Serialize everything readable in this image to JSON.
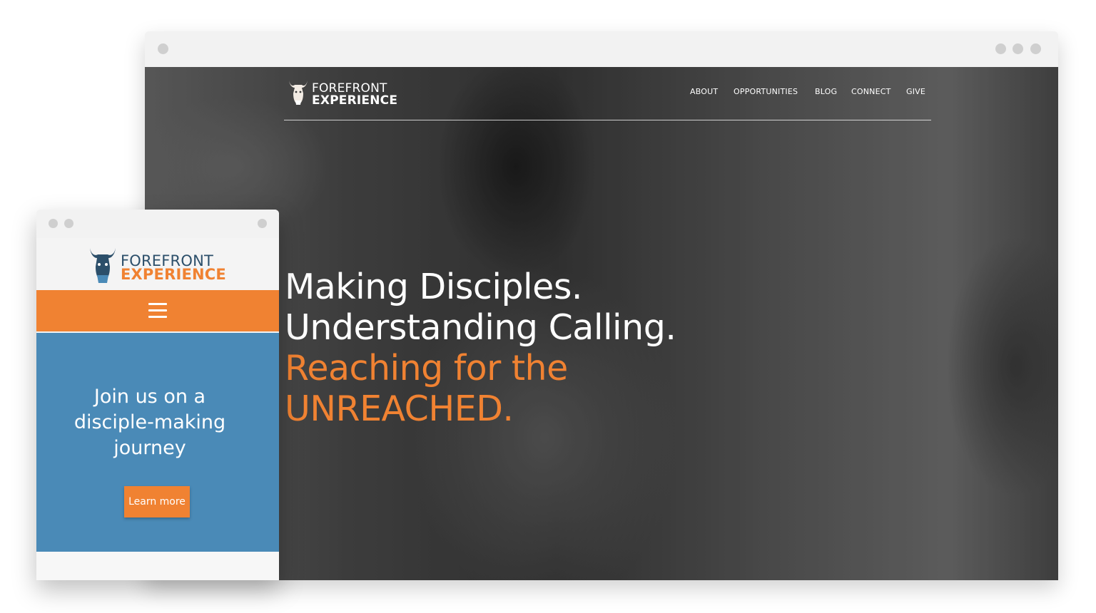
{
  "colors": {
    "accent_orange": "#f08232",
    "mobile_hero_blue": "#4a8ab7",
    "logo_navy": "#2c4f6a",
    "nav_text": "#ffffff"
  },
  "desktop": {
    "logo": {
      "line1": "FOREFRONT",
      "line2": "EXPERIENCE",
      "icon": "yak-head-icon"
    },
    "nav": {
      "items": [
        {
          "label": "ABOUT"
        },
        {
          "label": "OPPORTUNITIES"
        },
        {
          "label": "BLOG"
        },
        {
          "label": "CONNECT"
        },
        {
          "label": "GIVE"
        }
      ]
    },
    "hero": {
      "line1": "Making Disciples.",
      "line2": "Understanding Calling.",
      "line3": "Reaching for the",
      "line4": "UNREACHED."
    }
  },
  "mobile": {
    "logo": {
      "line1": "FOREFRONT",
      "line2": "EXPERIENCE",
      "icon": "yak-head-icon"
    },
    "menu_icon": "hamburger-menu-icon",
    "hero": {
      "line1": "Join us on a",
      "line2": "disciple-making",
      "line3": "journey"
    },
    "cta_label": "Learn more"
  }
}
